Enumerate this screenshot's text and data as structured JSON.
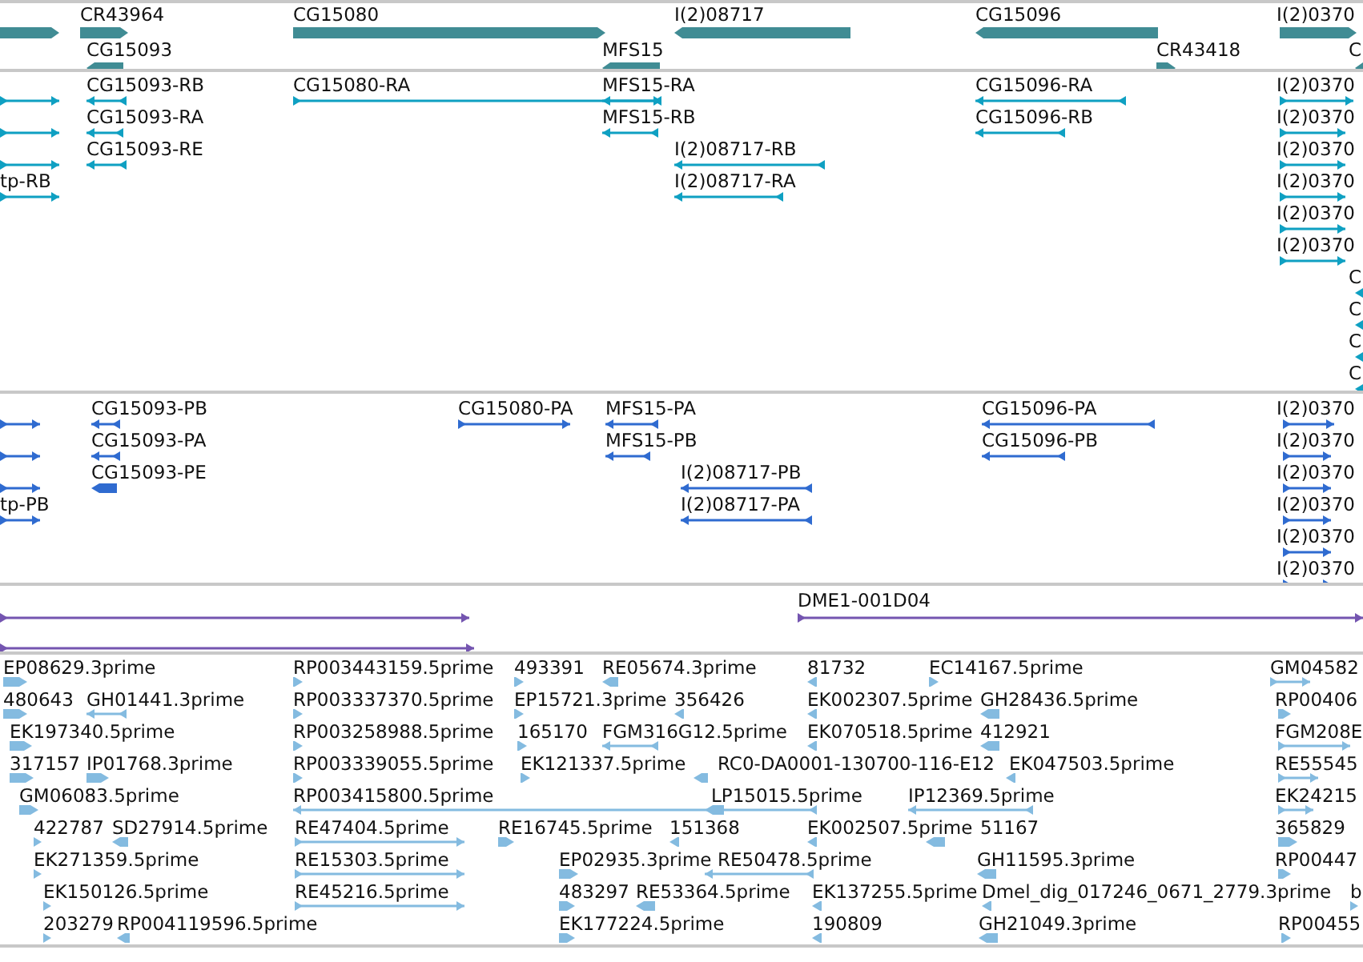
{
  "tracks": [
    {
      "kind": "genes",
      "color": "#408c94",
      "features": [
        {
          "reverse": false
        },
        {
          "label": "CR43964",
          "reverse": false
        },
        {
          "label": "CG15080",
          "reverse": false
        },
        {
          "label": "I(2)08717",
          "reverse": true
        },
        {
          "label": "CG15096",
          "reverse": true
        },
        {
          "label": "I(2)0370",
          "reverse": false
        },
        {
          "label": "CG15093",
          "reverse": true
        },
        {
          "label": "MFS15",
          "reverse": true
        },
        {
          "label": "CR43418",
          "reverse": false
        },
        {
          "label": "C",
          "reverse": true
        }
      ]
    },
    {
      "kind": "transcripts",
      "color": "#0fa0c2",
      "features": [
        {
          "reverse": false
        },
        {
          "reverse": false
        },
        {
          "reverse": false
        },
        {
          "label": "tp-RB",
          "reverse": false
        },
        {
          "label": "CG15093-RB",
          "reverse": true
        },
        {
          "label": "CG15093-RA",
          "reverse": true
        },
        {
          "label": "CG15093-RE",
          "reverse": true
        },
        {
          "label": "CG15080-RA",
          "reverse": false
        },
        {
          "label": "MFS15-RA",
          "reverse": true
        },
        {
          "label": "MFS15-RB",
          "reverse": true
        },
        {
          "label": "I(2)08717-RB",
          "reverse": true
        },
        {
          "label": "I(2)08717-RA",
          "reverse": true
        },
        {
          "label": "CG15096-RA",
          "reverse": true
        },
        {
          "label": "CG15096-RB",
          "reverse": true
        },
        {
          "label": "I(2)0370",
          "reverse": false
        },
        {
          "label": "I(2)0370",
          "reverse": false
        },
        {
          "label": "I(2)0370",
          "reverse": false
        },
        {
          "label": "I(2)0370",
          "reverse": false
        },
        {
          "label": "I(2)0370",
          "reverse": false
        },
        {
          "label": "I(2)0370",
          "reverse": false
        },
        {
          "label": "C",
          "reverse": true
        },
        {
          "label": "C",
          "reverse": true
        },
        {
          "label": "C",
          "reverse": true
        },
        {
          "label": "C",
          "reverse": true
        }
      ]
    },
    {
      "kind": "proteins",
      "color": "#2f6bd0",
      "features": [
        {
          "reverse": false
        },
        {
          "reverse": false
        },
        {
          "reverse": false
        },
        {
          "label": "tp-PB",
          "reverse": false
        },
        {
          "label": "CG15093-PB",
          "reverse": true
        },
        {
          "label": "CG15093-PA",
          "reverse": true
        },
        {
          "label": "CG15093-PE",
          "reverse": true
        },
        {
          "label": "CG15080-PA",
          "reverse": false
        },
        {
          "label": "MFS15-PA",
          "reverse": true
        },
        {
          "label": "MFS15-PB",
          "reverse": true
        },
        {
          "label": "I(2)08717-PB",
          "reverse": true
        },
        {
          "label": "I(2)08717-PA",
          "reverse": true
        },
        {
          "label": "CG15096-PA",
          "reverse": true
        },
        {
          "label": "CG15096-PB",
          "reverse": true
        },
        {
          "label": "I(2)0370",
          "reverse": false
        },
        {
          "label": "I(2)0370",
          "reverse": false
        },
        {
          "label": "I(2)0370",
          "reverse": false
        },
        {
          "label": "I(2)0370",
          "reverse": false
        },
        {
          "label": "I(2)0370",
          "reverse": false
        },
        {
          "label": "I(2)0370",
          "reverse": false
        }
      ]
    },
    {
      "kind": "clones",
      "color": "#7455b0",
      "features": [
        {
          "reverse": false
        },
        {
          "reverse": false
        },
        {
          "label": "DME1-001D04",
          "reverse": false
        }
      ]
    },
    {
      "kind": "ests",
      "color": "#84bbe0",
      "features": [
        {
          "label": "EP08629.3prime",
          "reverse": false
        },
        {
          "label": "RP003443159.5prime",
          "reverse": false
        },
        {
          "label": "493391",
          "reverse": false
        },
        {
          "label": "RE05674.3prime",
          "reverse": true
        },
        {
          "label": "81732",
          "reverse": true
        },
        {
          "label": "EC14167.5prime",
          "reverse": false
        },
        {
          "label": "GM04582",
          "reverse": false
        },
        {
          "label": "480643",
          "reverse": false
        },
        {
          "label": "GH01441.3prime",
          "reverse": true
        },
        {
          "label": "RP003337370.5prime",
          "reverse": false
        },
        {
          "label": "EP15721.3prime",
          "reverse": false
        },
        {
          "label": "356426",
          "reverse": true
        },
        {
          "label": "EK002307.5prime",
          "reverse": true
        },
        {
          "label": "GH28436.5prime",
          "reverse": true
        },
        {
          "label": "RP00406",
          "reverse": false
        },
        {
          "label": "EK197340.5prime",
          "reverse": false
        },
        {
          "label": "RP003258988.5prime",
          "reverse": false
        },
        {
          "label": "165170",
          "reverse": false
        },
        {
          "label": "FGM316G12.5prime",
          "reverse": true
        },
        {
          "label": "EK070518.5prime",
          "reverse": true
        },
        {
          "label": "412921",
          "reverse": true
        },
        {
          "label": "FGM208E",
          "reverse": false
        },
        {
          "label": "317157",
          "reverse": false
        },
        {
          "label": "IP01768.3prime",
          "reverse": false
        },
        {
          "label": "RP003339055.5prime",
          "reverse": false
        },
        {
          "label": "EK121337.5prime",
          "reverse": false
        },
        {
          "label": "RC0-DA0001-130700-116-E12",
          "reverse": true
        },
        {
          "label": "EK047503.5prime",
          "reverse": true
        },
        {
          "label": "RE55545",
          "reverse": false
        },
        {
          "label": "GM06083.5prime",
          "reverse": false
        },
        {
          "label": "RP003415800.5prime",
          "reverse": true
        },
        {
          "label": "LP15015.5prime",
          "reverse": true
        },
        {
          "label": "IP12369.5prime",
          "reverse": true
        },
        {
          "label": "EK24215",
          "reverse": false
        },
        {
          "label": "422787",
          "reverse": false
        },
        {
          "label": "SD27914.5prime",
          "reverse": true
        },
        {
          "label": "RE47404.5prime",
          "reverse": false
        },
        {
          "label": "RE16745.5prime",
          "reverse": false
        },
        {
          "label": "151368",
          "reverse": true
        },
        {
          "label": "EK002507.5prime",
          "reverse": true
        },
        {
          "label": "51167",
          "reverse": true
        },
        {
          "label": "365829",
          "reverse": false
        },
        {
          "label": "EK271359.5prime",
          "reverse": false
        },
        {
          "label": "RE15303.5prime",
          "reverse": false
        },
        {
          "label": "EP02935.3prime",
          "reverse": false
        },
        {
          "label": "RE50478.5prime",
          "reverse": true
        },
        {
          "label": "GH11595.3prime",
          "reverse": true
        },
        {
          "label": "RP00447",
          "reverse": false
        },
        {
          "label": "EK150126.5prime",
          "reverse": false
        },
        {
          "label": "RE45216.5prime",
          "reverse": false
        },
        {
          "label": "483297",
          "reverse": false
        },
        {
          "label": "RE53364.5prime",
          "reverse": true
        },
        {
          "label": "EK137255.5prime",
          "reverse": true
        },
        {
          "label": "Dmel_dig_017246_0671_2779.3prime",
          "reverse": true
        },
        {
          "label": "b",
          "reverse": false
        },
        {
          "label": "203279",
          "reverse": false
        },
        {
          "label": "RP004119596.5prime",
          "reverse": true
        },
        {
          "label": "EK177224.5prime",
          "reverse": false
        },
        {
          "label": "190809",
          "reverse": true
        },
        {
          "label": "GH21049.3prime",
          "reverse": true
        },
        {
          "label": "RP00455",
          "reverse": false
        }
      ]
    }
  ]
}
